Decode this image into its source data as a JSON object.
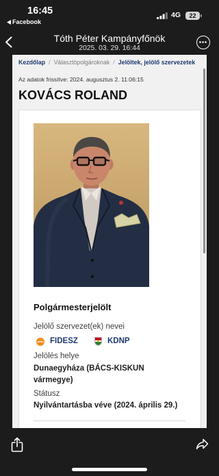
{
  "status_bar": {
    "time": "16:45",
    "back_app": "Facebook",
    "network": "4G",
    "battery": "22",
    "signal_icon": "cellular-signal-icon",
    "back_icon": "back-triangle-icon"
  },
  "header": {
    "title": "Tóth Péter Kampányfőnök",
    "subtitle": "2025. 03. 29. 16:44",
    "back_icon": "chevron-left-icon",
    "more_icon": "more-options-icon"
  },
  "page": {
    "breadcrumb": [
      {
        "label": "Kezdőlap"
      },
      {
        "label": "Választópolgároknak"
      },
      {
        "label": "Jelöltek, jelölő szervezetek"
      }
    ],
    "breadcrumb_separator": "/",
    "updated_text": "Az adatok frissítve: 2024. augusztus 2. 11:06:15",
    "candidate": {
      "name": "KOVÁCS ROLAND",
      "role": "Polgármesterjelölt",
      "organizations_label": "Jelölő szervezet(ek) nevei",
      "organizations": [
        {
          "name": "FIDESZ",
          "logo_icon": "fidesz-logo-icon"
        },
        {
          "name": "KDNP",
          "logo_icon": "kdnp-logo-icon"
        }
      ],
      "nomination_place_label": "Jelölés helye",
      "nomination_place": "Dunaegyháza (BÁCS-KISKUN vármegye)",
      "status_label": "Státusz",
      "status": "Nyilvántartásba véve (2024. április 29.)"
    }
  },
  "bottom_bar": {
    "share_icon": "share-icon",
    "forward_icon": "forward-share-icon"
  },
  "colors": {
    "app_background": "#1c1c1c",
    "page_background": "#f1f1f1",
    "card_background": "#ffffff",
    "link_navy": "#1d3a6e",
    "fidesz_orange": "#f28c1e"
  }
}
